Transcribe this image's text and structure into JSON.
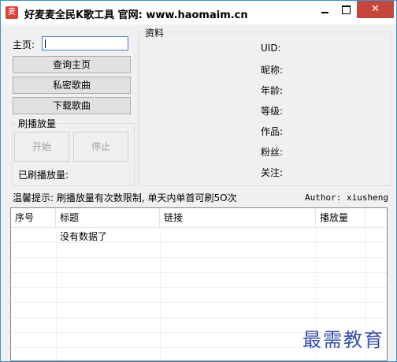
{
  "titlebar": {
    "icon_glyph": "麦",
    "title": "好麦麦全民K歌工具  官网: www.haomaim.cn",
    "close_glyph": "✕"
  },
  "left": {
    "homepage_label": "主页:",
    "homepage_value": "",
    "query_button": "查询主页",
    "private_button": "私密歌曲",
    "download_button": "下载歌曲",
    "play_group_title": "刷播放量",
    "start_button": "开始",
    "stop_button": "停止",
    "played_label": "已刷播放量:"
  },
  "info": {
    "group_title": "资料",
    "labels": [
      "UID:",
      "昵称:",
      "年龄:",
      "等级:",
      "作品:",
      "粉丝:",
      "关注:"
    ]
  },
  "tip": "温馨提示: 刷播放量有次数限制, 单天内单首可刷5O次",
  "author": "Author: xiusheng",
  "table": {
    "headers": [
      "序号",
      "标题",
      "链接",
      "播放量"
    ],
    "empty_text": "没有数据了"
  },
  "watermark": "最需教育",
  "colors": {
    "close_button": "#c7463b",
    "border_accent": "#3c8fd6",
    "watermark": "#3250b0"
  }
}
